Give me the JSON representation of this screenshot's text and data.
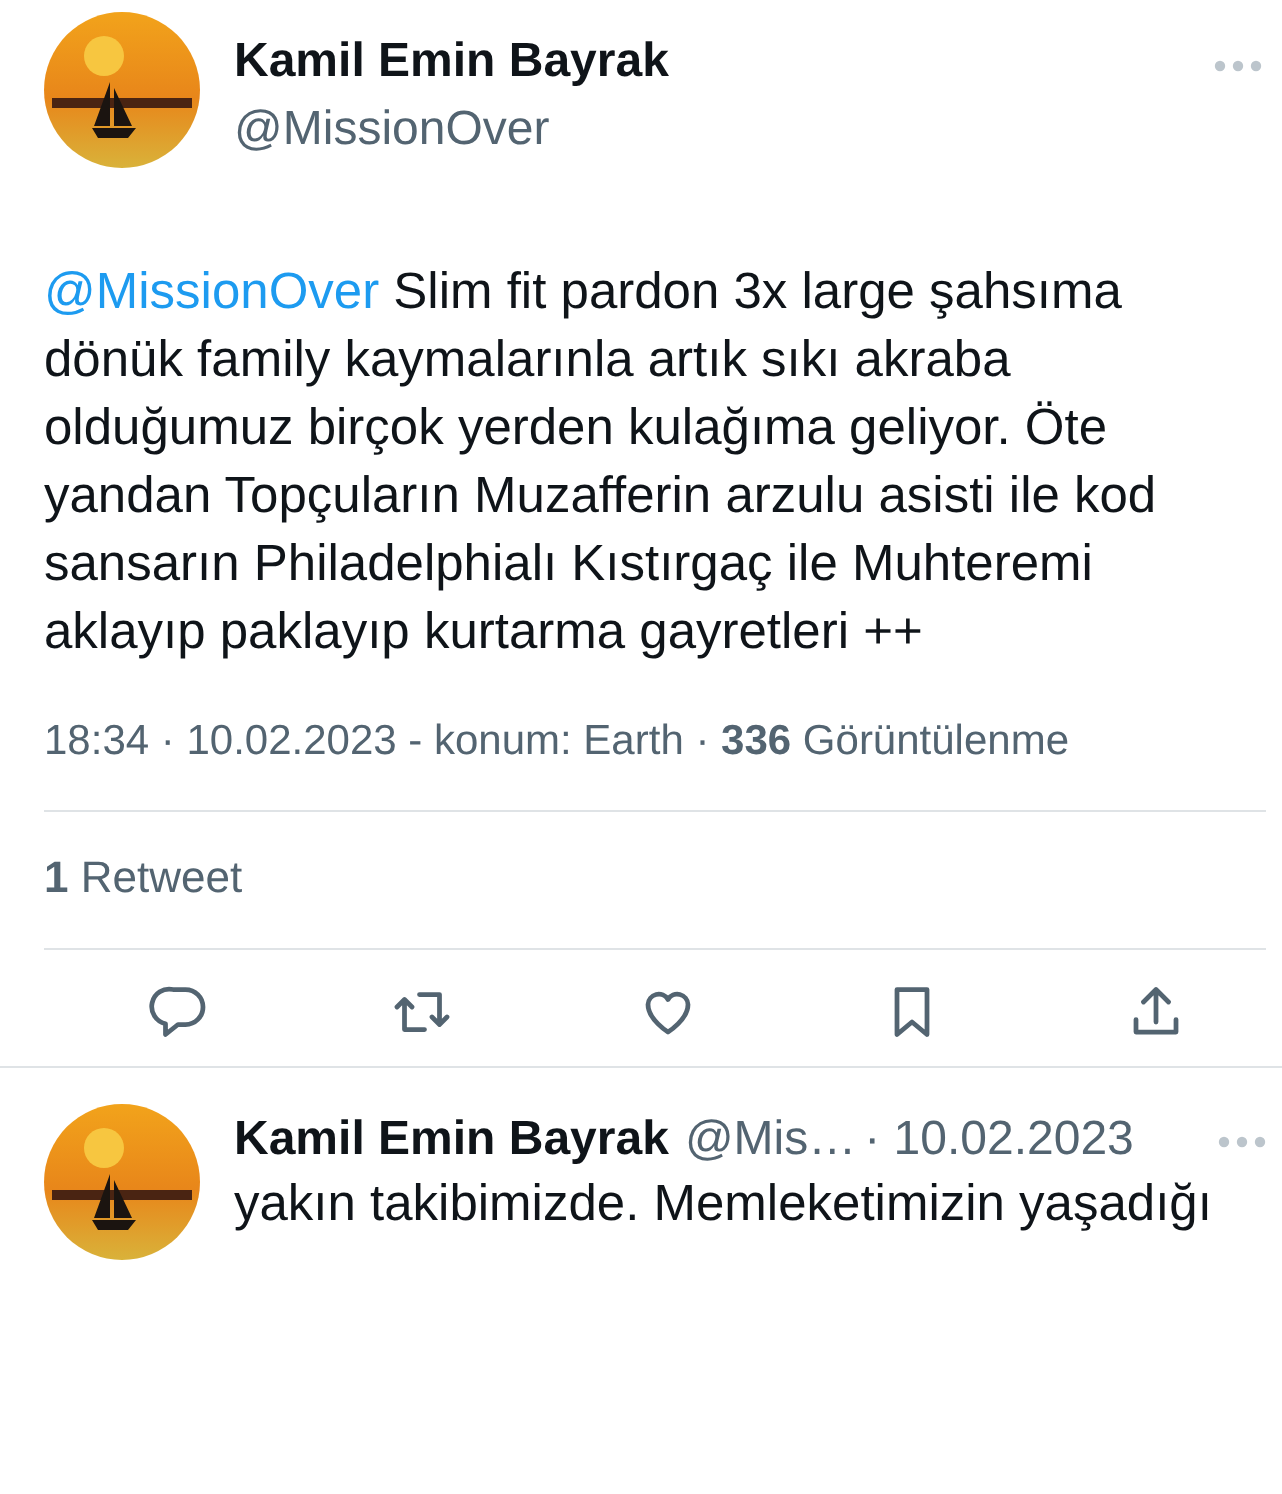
{
  "tweet": {
    "author": {
      "name": "Kamil Emin Bayrak",
      "handle": "@MissionOver"
    },
    "mention": "@MissionOver",
    "text": "Slim fit pardon 3x large şahsıma dönük family kaymalarınla artık sıkı akraba olduğumuz birçok yerden kulağıma geliyor. Öte yandan Topçuların Muzafferin arzulu asisti ile kod sansarın Philadelphialı Kıstırgaç ile Muhteremi aklayıp paklayıp kurtarma gayretleri ++",
    "meta": "18:34 · 10.02.2023 - konum: Earth · **336** Görüntülenme",
    "stats": "**1** Retweet",
    "actions": [
      {
        "kind": "reply"
      },
      {
        "kind": "retweet"
      },
      {
        "kind": "like"
      },
      {
        "kind": "bookmark"
      },
      {
        "kind": "share"
      }
    ]
  },
  "reply": {
    "name": "Kamil Emin Bayrak",
    "handle": "@Mis…",
    "date": "· 10.02.2023",
    "text": "yakın takibimizde. Memleketimizin yaşadığı"
  }
}
